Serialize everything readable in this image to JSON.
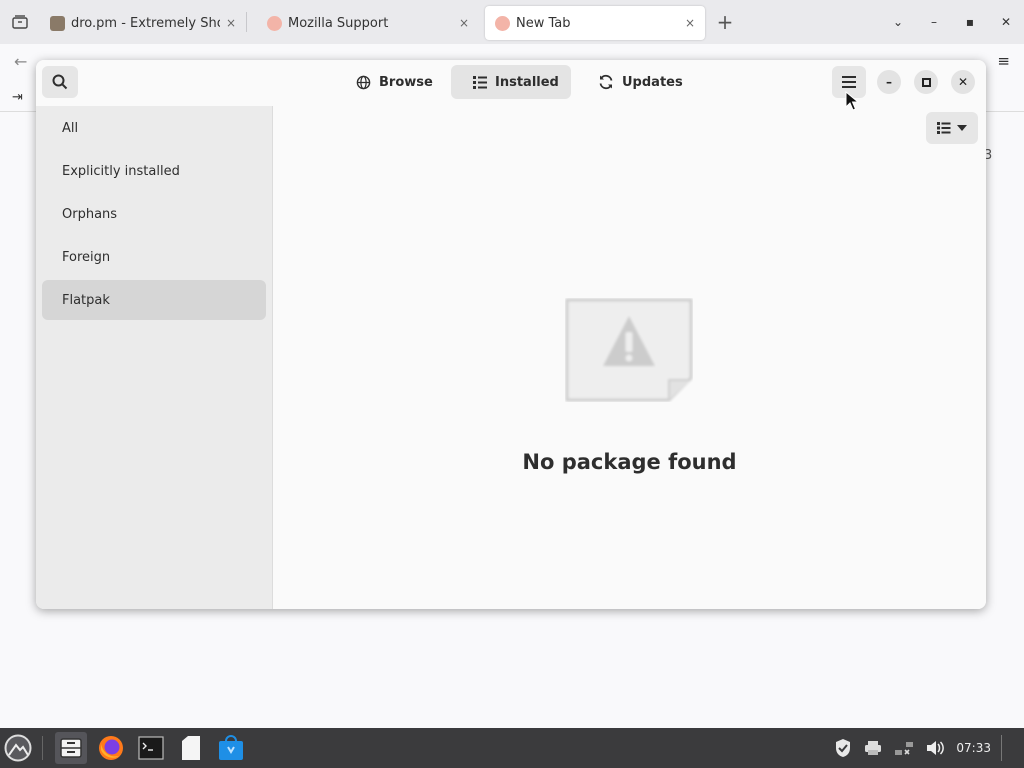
{
  "browser": {
    "tabs": [
      {
        "title": "dro.pm - Extremely Short Lin",
        "favicon_color": "#8a7a68",
        "active": false
      },
      {
        "title": "Mozilla Support",
        "favicon_color": "#e86a5a",
        "active": false
      },
      {
        "title": "New Tab",
        "favicon_color": "#e86a5a",
        "active": true
      }
    ],
    "new_tab_symbol": "+",
    "close_symbol": "×",
    "back_symbol": "←",
    "menu_symbol": "≡",
    "page_digit": "3"
  },
  "app": {
    "views": [
      {
        "label": "Browse",
        "icon": "globe-icon"
      },
      {
        "label": "Installed",
        "icon": "list-icon",
        "active": true
      },
      {
        "label": "Updates",
        "icon": "refresh-icon"
      }
    ],
    "window_controls": {
      "minimize": "–",
      "maximize": "◻",
      "close": "✕"
    },
    "sidebar": [
      {
        "label": "All"
      },
      {
        "label": "Explicitly installed"
      },
      {
        "label": "Orphans"
      },
      {
        "label": "Foreign"
      },
      {
        "label": "Flatpak",
        "selected": true
      }
    ],
    "empty_state": {
      "message": "No package found",
      "icon": "warning-icon"
    }
  },
  "taskbar": {
    "clock": "07:33",
    "icons": [
      "start-menu-icon",
      "file-manager-icon",
      "firefox-icon",
      "terminal-icon",
      "files-icon",
      "software-store-icon"
    ]
  },
  "colors": {
    "accent": "#e4e4e4",
    "taskbar": "#3b3b3d"
  }
}
